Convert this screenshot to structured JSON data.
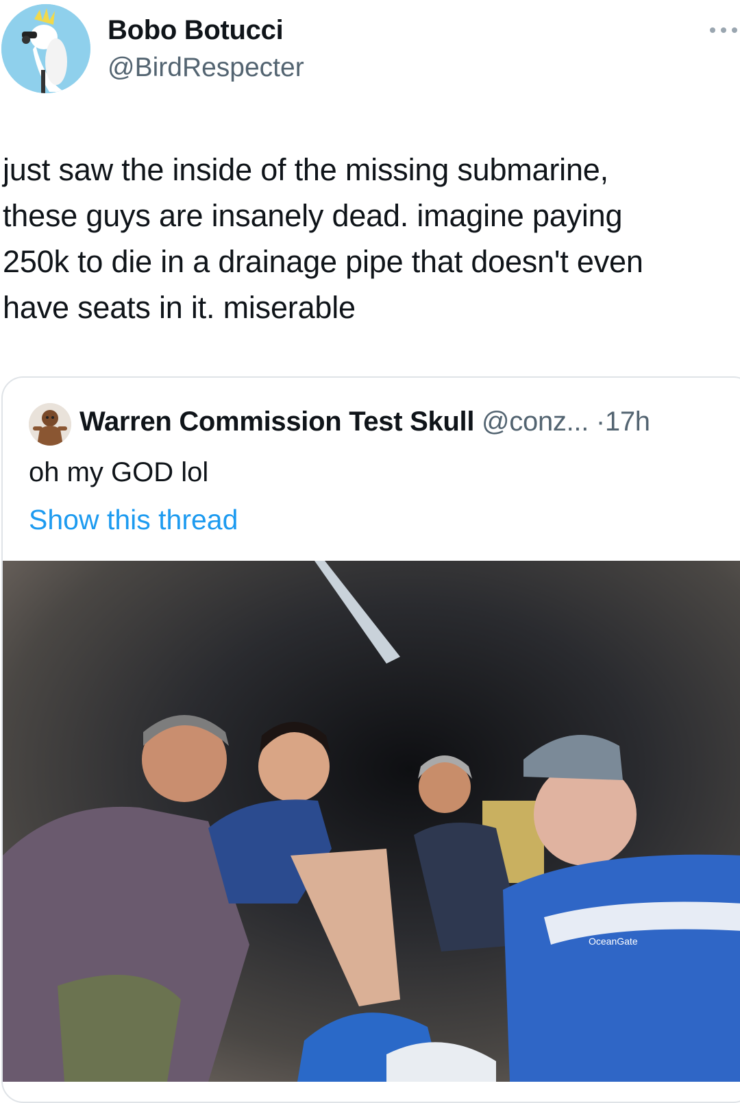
{
  "author": {
    "display_name": "Bobo Botucci",
    "handle": "@BirdRespecter",
    "avatar_icon": "cockatoo-avatar-icon",
    "more_icon": "more-options-icon"
  },
  "tweet": {
    "text": "just saw the inside of the missing submarine,\nthese guys are insanely dead. imagine paying\n250k to die in a drainage pipe that doesn't even\nhave seats in it. miserable"
  },
  "quoted_tweet": {
    "display_name": "Warren Commission Test Skull",
    "handle": "@conz...",
    "separator": "·",
    "time": "17h",
    "text": "oh my GOD lol",
    "show_thread_label": "Show this thread",
    "avatar_icon": "skull-avatar-icon",
    "link_color": "#1d9bf0",
    "photo_label": "OceanGate"
  },
  "colors": {
    "text": "#0f1419",
    "secondary": "#536471",
    "border": "#dfe3e7",
    "avatar_bg": "#8fd0ec"
  }
}
